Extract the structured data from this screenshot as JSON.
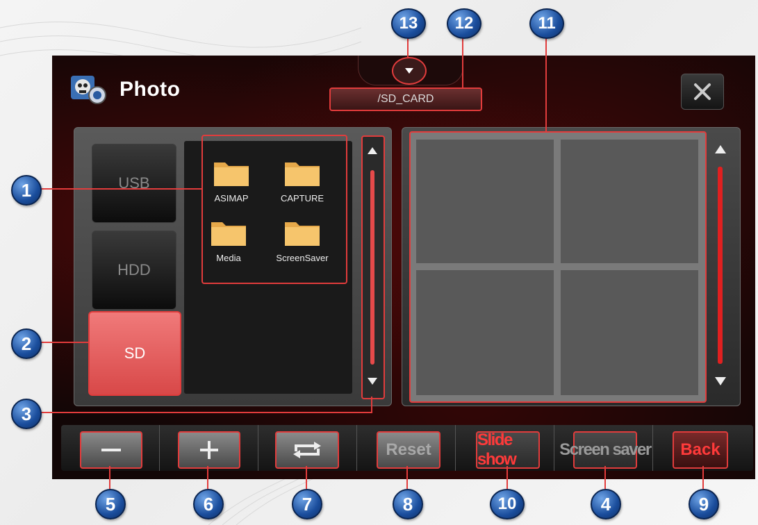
{
  "app": {
    "title": "Photo"
  },
  "path": {
    "current": "/SD_CARD"
  },
  "sources": [
    {
      "label": "USB",
      "active": false
    },
    {
      "label": "HDD",
      "active": false
    },
    {
      "label": "SD",
      "active": true
    }
  ],
  "folders": [
    {
      "name": "ASIMAP"
    },
    {
      "name": "CAPTURE"
    },
    {
      "name": "Media"
    },
    {
      "name": "ScreenSaver"
    }
  ],
  "toolbar": {
    "reset_label": "Reset",
    "slideshow_label": "Slide show",
    "screensaver_label": "Screen saver",
    "back_label": "Back"
  },
  "callouts": {
    "c1": "1",
    "c2": "2",
    "c3": "3",
    "c4": "4",
    "c5": "5",
    "c6": "6",
    "c7": "7",
    "c8": "8",
    "c9": "9",
    "c10": "10",
    "c11": "11",
    "c12": "12",
    "c13": "13"
  },
  "colors": {
    "accent": "#e23c3c",
    "callout": "#1a4d9c",
    "active_source": "#e85a5a"
  }
}
